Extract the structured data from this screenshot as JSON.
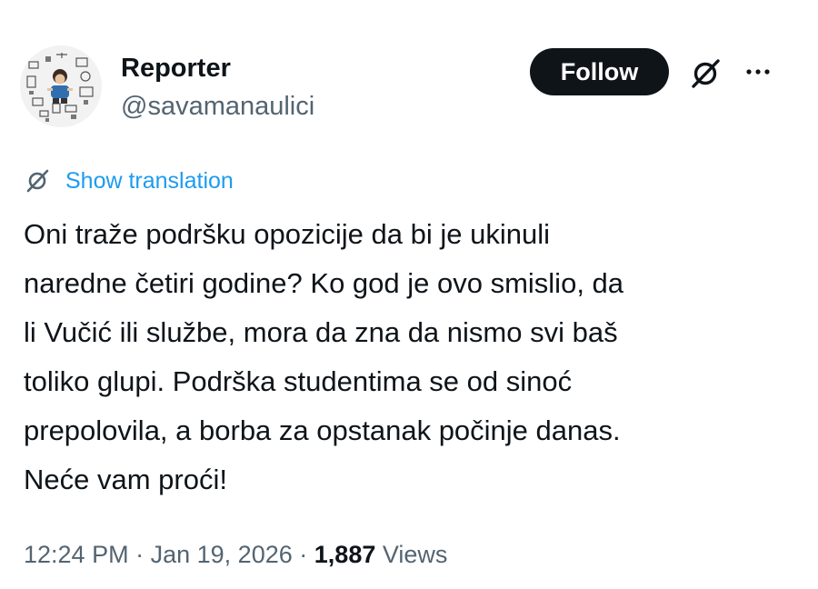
{
  "author": {
    "display_name": "Reporter",
    "handle": "@savamanaulici"
  },
  "actions": {
    "follow_label": "Follow",
    "grok_icon": "grok-slash-circle-icon",
    "more_icon": "more-dots-icon"
  },
  "translation": {
    "label": "Show translation",
    "icon": "grok-slash-circle-icon"
  },
  "tweet": {
    "lines": [
      "Oni traže podršku opozicije da bi je ukinuli",
      "naredne četiri godine? Ko god je ovo smislio, da",
      "li Vučić ili službe, mora da zna da nismo svi baš",
      "toliko glupi. Podrška studentima se od sinoć",
      "prepolovila, a borba za opstanak počinje danas.",
      "Neće vam proći!"
    ]
  },
  "meta": {
    "time": "12:24 PM",
    "date": "Jan 19, 2026",
    "separator": "·",
    "views_count": "1,887",
    "views_label": "Views"
  },
  "colors": {
    "text_primary": "#0f1419",
    "text_secondary": "#536471",
    "link_blue": "#1d9bf0",
    "button_bg": "#0f1419",
    "button_text": "#ffffff"
  }
}
